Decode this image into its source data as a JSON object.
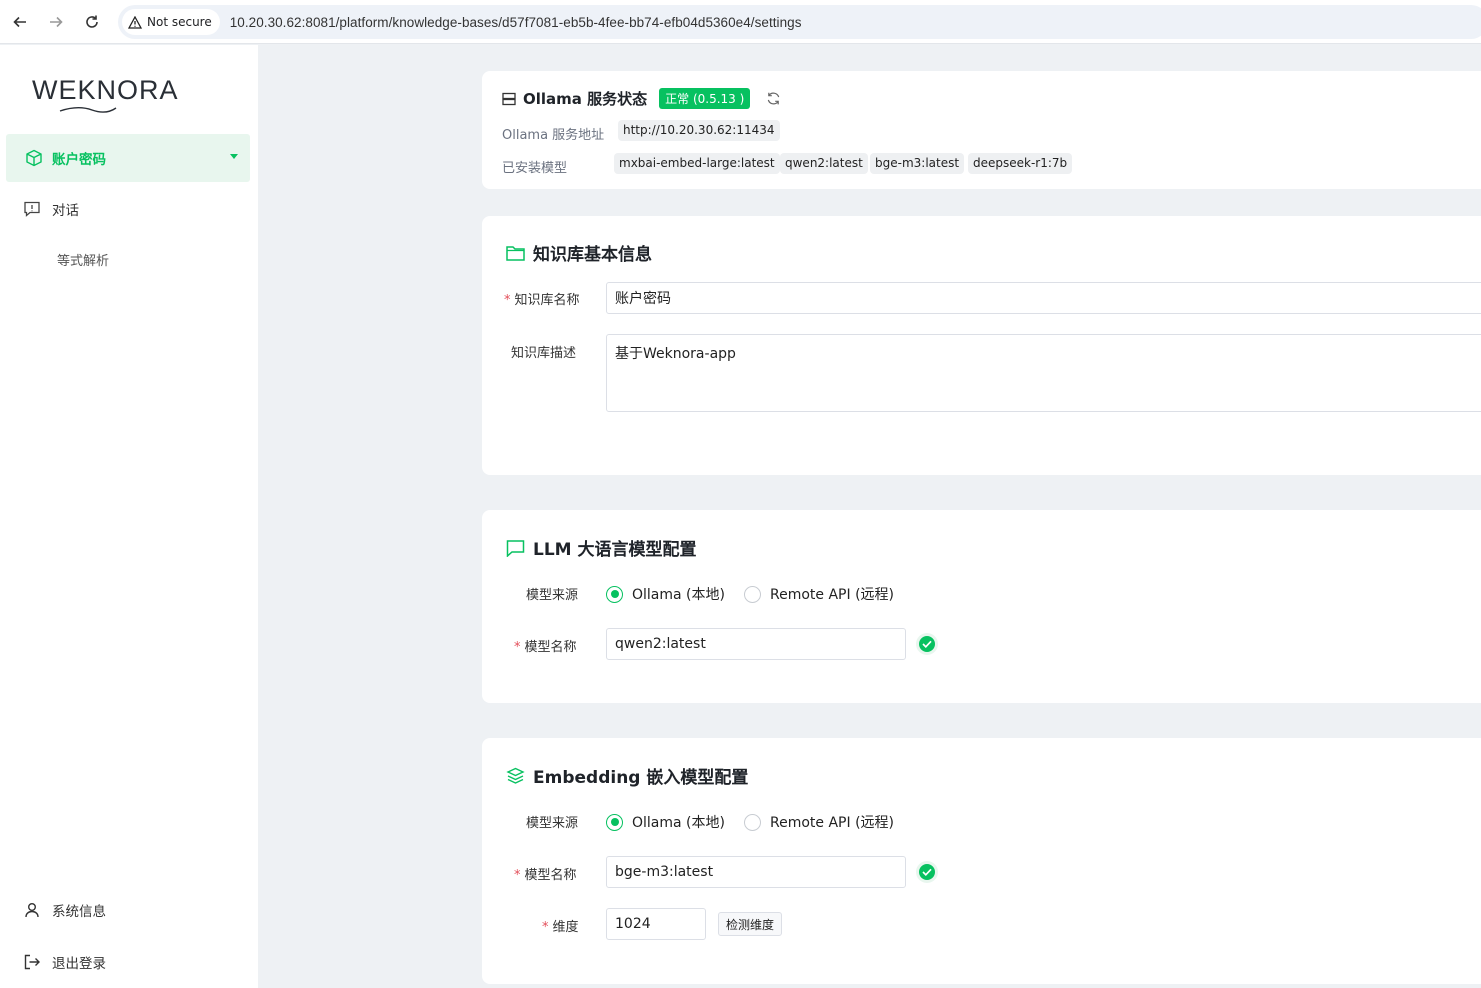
{
  "browser": {
    "security_label": "Not secure",
    "url": "10.20.30.62:8081/platform/knowledge-bases/d57f7081-eb5b-4fee-bb74-efb04d5360e4/settings"
  },
  "sidebar": {
    "logo": "WEKNORA",
    "active_item": "账户密码",
    "items": [
      {
        "label": "对话"
      },
      {
        "label": "等式解析"
      }
    ],
    "footer": [
      {
        "label": "系统信息"
      },
      {
        "label": "退出登录"
      }
    ]
  },
  "ollama": {
    "title": "Ollama 服务状态",
    "status": "正常 (0.5.13 )",
    "address_label": "Ollama 服务地址",
    "address": "http://10.20.30.62:11434",
    "models_label": "已安装模型",
    "models": [
      "mxbai-embed-large:latest",
      "qwen2:latest",
      "bge-m3:latest",
      "deepseek-r1:7b"
    ]
  },
  "kb_info": {
    "title": "知识库基本信息",
    "name_label": "知识库名称",
    "name_value": "账户密码",
    "desc_label": "知识库描述",
    "desc_value": "基于Weknora-app"
  },
  "llm": {
    "title": "LLM 大语言模型配置",
    "source_label": "模型来源",
    "source_options": [
      "Ollama (本地)",
      "Remote API (远程)"
    ],
    "selected_source": "Ollama (本地)",
    "model_label": "模型名称",
    "model_value": "qwen2:latest"
  },
  "embedding": {
    "title": "Embedding 嵌入模型配置",
    "source_label": "模型来源",
    "source_options": [
      "Ollama (本地)",
      "Remote API (远程)"
    ],
    "selected_source": "Ollama (本地)",
    "model_label": "模型名称",
    "model_value": "bge-m3:latest",
    "dim_label": "维度",
    "dim_value": "1024",
    "detect_button": "检测维度"
  },
  "colors": {
    "accent": "#07c160",
    "required": "#e34d59",
    "page_bg": "#eef1f4"
  }
}
